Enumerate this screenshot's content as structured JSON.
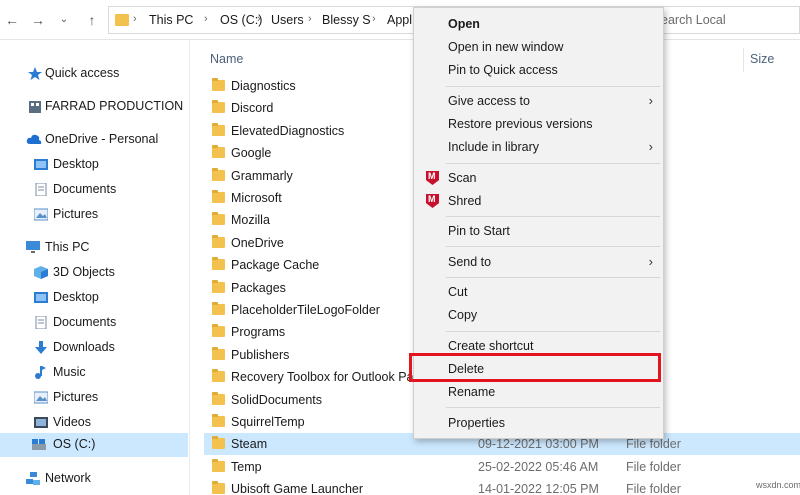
{
  "address_bar": {
    "nav_back_icon": "arrow-left-icon",
    "nav_forward_icon": "arrow-right-icon",
    "nav_dropdown_icon": "chevron-down-icon",
    "nav_up_icon": "arrow-up-icon",
    "breadcrumbs": [
      "This PC",
      "OS (C:)",
      "Users",
      "Blessy S",
      "Appl"
    ],
    "search_placeholder": "earch Local"
  },
  "sidebar": {
    "items": [
      {
        "label": "Quick access",
        "icon": "star-icon"
      },
      {
        "label": "FARRAD PRODUCTION",
        "icon": "building-icon"
      },
      {
        "label": "OneDrive - Personal",
        "icon": "cloud-icon"
      },
      {
        "label": "Desktop",
        "icon": "desktop-folder-icon"
      },
      {
        "label": "Documents",
        "icon": "documents-icon"
      },
      {
        "label": "Pictures",
        "icon": "pictures-icon"
      },
      {
        "label": "This PC",
        "icon": "computer-icon"
      },
      {
        "label": "3D Objects",
        "icon": "cube-icon"
      },
      {
        "label": "Desktop",
        "icon": "desktop-folder-icon"
      },
      {
        "label": "Documents",
        "icon": "documents-icon"
      },
      {
        "label": "Downloads",
        "icon": "download-icon"
      },
      {
        "label": "Music",
        "icon": "music-icon"
      },
      {
        "label": "Pictures",
        "icon": "pictures-icon"
      },
      {
        "label": "Videos",
        "icon": "video-icon"
      },
      {
        "label": "OS (C:)",
        "icon": "drive-icon",
        "selected": true
      },
      {
        "label": "Network",
        "icon": "network-icon"
      }
    ]
  },
  "file_list": {
    "columns": {
      "name": "Name",
      "size": "Size"
    },
    "rows": [
      {
        "name": "Diagnostics",
        "date": "",
        "type": "older"
      },
      {
        "name": "Discord",
        "date": "",
        "type": "older"
      },
      {
        "name": "ElevatedDiagnostics",
        "date": "",
        "type": "older"
      },
      {
        "name": "Google",
        "date": "",
        "type": "older"
      },
      {
        "name": "Grammarly",
        "date": "",
        "type": "older"
      },
      {
        "name": "Microsoft",
        "date": "",
        "type": "older"
      },
      {
        "name": "Mozilla",
        "date": "",
        "type": "older"
      },
      {
        "name": "OneDrive",
        "date": "",
        "type": "older"
      },
      {
        "name": "Package Cache",
        "date": "",
        "type": "older"
      },
      {
        "name": "Packages",
        "date": "",
        "type": "older"
      },
      {
        "name": "PlaceholderTileLogoFolder",
        "date": "",
        "type": "older"
      },
      {
        "name": "Programs",
        "date": "",
        "type": "older"
      },
      {
        "name": "Publishers",
        "date": "",
        "type": "older"
      },
      {
        "name": "Recovery Toolbox for Outlook Pa",
        "date": "",
        "type": "older"
      },
      {
        "name": "SolidDocuments",
        "date": "",
        "type": "older"
      },
      {
        "name": "SquirrelTemp",
        "date": "",
        "type": "older"
      },
      {
        "name": "Steam",
        "date": "09-12-2021 03:00 PM",
        "type": "File folder",
        "selected": true
      },
      {
        "name": "Temp",
        "date": "25-02-2022 05:46 AM",
        "type": "File folder"
      },
      {
        "name": "Ubisoft Game Launcher",
        "date": "14-01-2022 12:05 PM",
        "type": "File folder"
      }
    ]
  },
  "context_menu": {
    "items": [
      {
        "label": "Open",
        "bold": true
      },
      {
        "label": "Open in new window"
      },
      {
        "label": "Pin to Quick access"
      },
      {
        "label": "Give access to",
        "submenu": true
      },
      {
        "label": "Restore previous versions"
      },
      {
        "label": "Include in library",
        "submenu": true
      },
      {
        "label": "Scan",
        "icon": "mcafee-icon"
      },
      {
        "label": "Shred",
        "icon": "mcafee-icon"
      },
      {
        "label": "Pin to Start"
      },
      {
        "label": "Send to",
        "submenu": true
      },
      {
        "label": "Cut"
      },
      {
        "label": "Copy"
      },
      {
        "label": "Create shortcut"
      },
      {
        "label": "Delete",
        "highlighted": true
      },
      {
        "label": "Rename"
      },
      {
        "label": "Properties"
      }
    ],
    "highlight_color": "#e3141f"
  },
  "watermark": "wsxdn.com",
  "colors": {
    "selection": "#cce8ff",
    "folder": "#f2c14e",
    "menu_bg": "#f2f2f2"
  }
}
